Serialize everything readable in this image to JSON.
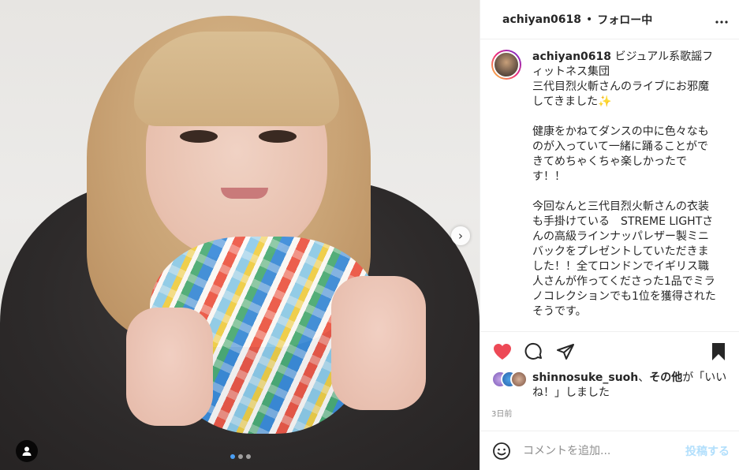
{
  "header": {
    "username": "achiyan0618",
    "separator": "•",
    "follow_status": "フォロー中",
    "more_icon": "more-horizontal-icon"
  },
  "post": {
    "username": "achiyan0618",
    "caption": "ビジュアル系歌謡フィットネス集団\n三代目烈火斬さんのライブにお邪魔してきました✨\n\n健康をかねてダンスの中に色々なものが入っていて一緒に踊ることができてめちゃくちゃ楽しかったです！！\n\n今回なんと三代目烈火斬さんの衣装も手掛けている　STREME LIGHTさんの高級ラインナッパレザー製ミニバックをプレゼントしていただきました！！全てロンドンでイギリス職人さんが作ってくださった1品でミラノコレクションでも1位を獲得されたそうです。\n\n大切に使います！！\nこの度はありがとうございました😭"
  },
  "media": {
    "carousel_next": "›",
    "dots": 3,
    "active_dot": 0
  },
  "likes": {
    "user": "shinnosuke_suoh",
    "separator": "、",
    "others": "その他",
    "suffix": "が「いいね！」しました"
  },
  "timestamp": "3日前",
  "comment_box": {
    "placeholder": "コメントを追加...",
    "post_label": "投稿する"
  },
  "colors": {
    "heart": "#ed4956",
    "post_disabled": "#b2dffc",
    "secondary_text": "#8e8e8e"
  }
}
